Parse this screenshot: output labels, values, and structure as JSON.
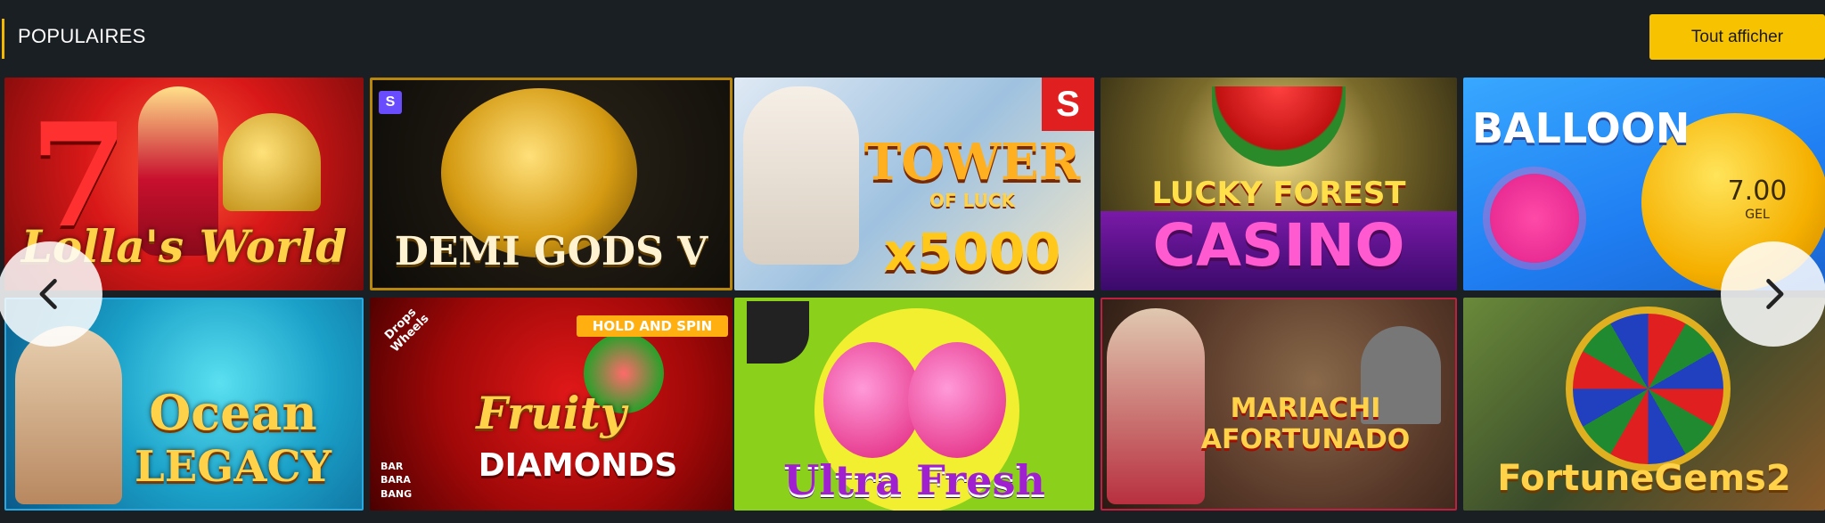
{
  "header": {
    "title": "POPULAIRES",
    "show_all_label": "Tout afficher"
  },
  "colors": {
    "background": "#1a1f24",
    "accent": "#f7c300"
  },
  "games": [
    {
      "title": "Lolla's World"
    },
    {
      "title": "DEMI GODS V"
    },
    {
      "title": "TOWER",
      "subtitle": "OF LUCK",
      "extra": "x5000"
    },
    {
      "title": "LUCKY FOREST",
      "subtitle": "CASINO"
    },
    {
      "title": "BALLOON",
      "extra": "7.00",
      "extra2": "GEL"
    },
    {
      "title": "Ocean",
      "subtitle": "LEGACY"
    },
    {
      "title": "Fruity",
      "subtitle": "DIAMONDS",
      "badge": "HOLD AND SPIN",
      "corner": "Drops Wheels",
      "studio": "BAR BARA BANG"
    },
    {
      "title": "Ultra Fresh"
    },
    {
      "title": "MARIACHI",
      "subtitle": "AFORTUNADO"
    },
    {
      "title": "FortuneGems2"
    }
  ],
  "nav": {
    "prev_icon": "chevron-left-icon",
    "next_icon": "chevron-right-icon"
  }
}
